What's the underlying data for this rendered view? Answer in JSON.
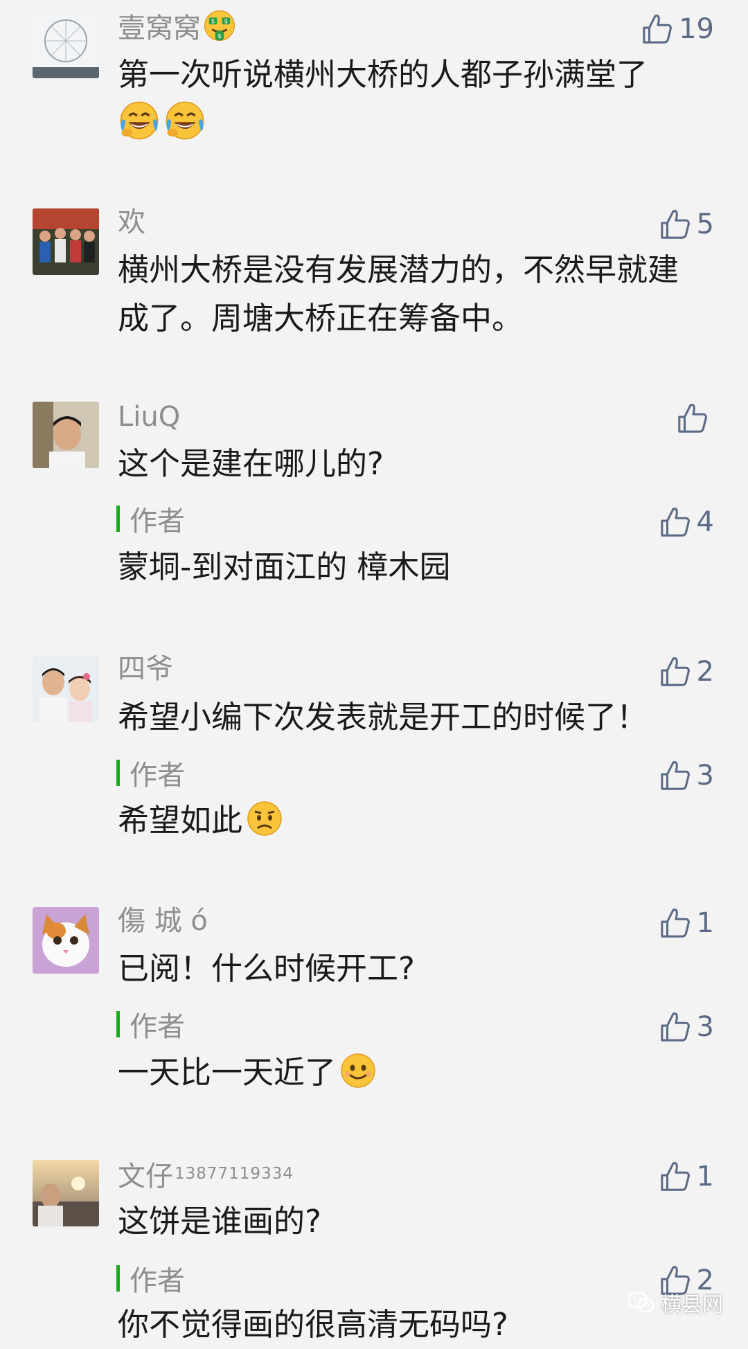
{
  "comments": [
    {
      "nickname": "壹窝窝",
      "nickname_emoji": "money-mouth-face",
      "likes": "19",
      "text": "第一次听说横州大桥的人都子孙满堂了",
      "text_emojis": [
        "laughing-crying-face",
        "laughing-crying-face"
      ]
    },
    {
      "nickname": "欢",
      "likes": "5",
      "text": "横州大桥是没有发展潜力的，不然早就建成了。周塘大桥正在筹备中。"
    },
    {
      "nickname": "LiuQ",
      "likes": "",
      "text": "这个是建在哪儿的?",
      "reply": {
        "label": "作者",
        "likes": "4",
        "text": "蒙垌-到对面江的 樟木园"
      }
    },
    {
      "nickname": "四爷",
      "likes": "2",
      "text": "希望小编下次发表就是开工的时候了！",
      "reply": {
        "label": "作者",
        "likes": "3",
        "text": "希望如此",
        "emoji": "frowning-face"
      }
    },
    {
      "nickname": "傷 城 ó",
      "likes": "1",
      "text": "已阅！什么时候开工?",
      "reply": {
        "label": "作者",
        "likes": "3",
        "text": "一天比一天近了",
        "emoji": "smiling-face"
      }
    },
    {
      "nickname": "文仔",
      "nickname_suffix": "13877119334",
      "likes": "1",
      "text": "这饼是谁画的?",
      "reply": {
        "label": "作者",
        "likes": "2",
        "text": "你不觉得画的很高清无码吗?"
      }
    }
  ],
  "watermark": {
    "text": "横县网",
    "icon": "wechat-icon"
  },
  "colors": {
    "like": "#5b6b86",
    "author_bar": "#1aad19",
    "nickname": "#8e8e8e",
    "background": "#f3f3f3"
  }
}
